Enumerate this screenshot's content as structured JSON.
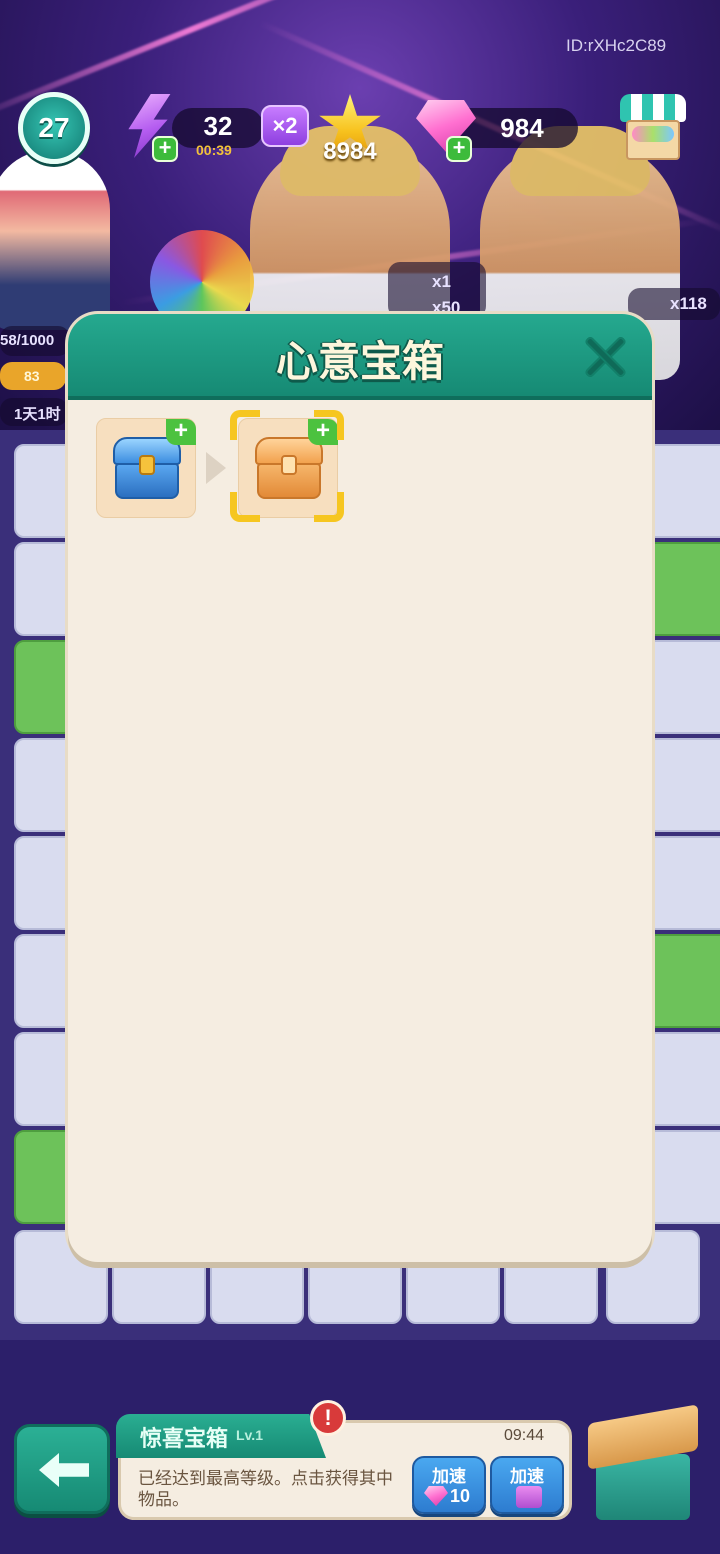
{
  "hud": {
    "player_id": "ID:rXHc2C89",
    "level": "27",
    "energy": "32",
    "energy_timer": "00:39",
    "multiplier": "×2",
    "stars": "8984",
    "gems": "984"
  },
  "peek": {
    "chest_count": "x1",
    "star_reward": "x50",
    "star_total": "x118",
    "progress": "58/1000",
    "counter": "83",
    "event_time": "1天1时"
  },
  "modal": {
    "title": "心意宝箱",
    "items": [
      {
        "name": "blue-chest",
        "has_plus": true,
        "selected": false
      },
      {
        "name": "orange-chest",
        "has_plus": true,
        "selected": true
      }
    ]
  },
  "bottom": {
    "panel_title": "惊喜宝箱",
    "panel_level": "Lv.1",
    "alert": "!",
    "time": "09:44",
    "description": "已经达到最高等级。点击获得其中物品。",
    "speed_label_1": "加速",
    "speed_cost_1": "10",
    "speed_label_2": "加速"
  },
  "icons": [
    "level-badge",
    "energy-bolt-icon",
    "plus-icon",
    "multiplier-icon",
    "star-icon",
    "gem-icon",
    "shop-icon",
    "close-icon",
    "chest-icon",
    "back-arrow-icon",
    "alert-icon",
    "gift-box-icon"
  ]
}
